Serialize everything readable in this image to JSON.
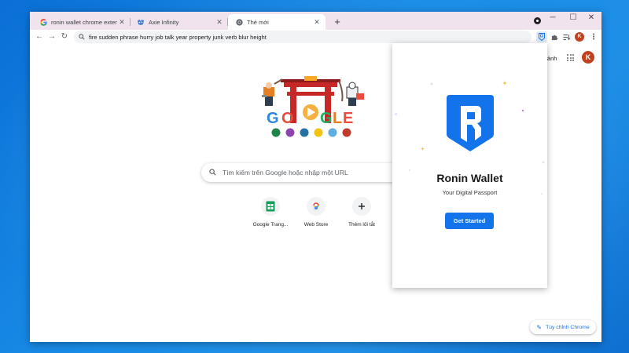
{
  "browser": {
    "tabs": [
      {
        "title": "ronin wallet chrome extension - Go",
        "active": false,
        "favicon": "google-g-icon"
      },
      {
        "title": "Axie Infinity",
        "active": false,
        "favicon": "axie-icon"
      },
      {
        "title": "Thẻ mới",
        "active": true,
        "favicon": "chrome-icon"
      }
    ],
    "new_tab_symbol": "+",
    "window_controls": {
      "minimize": "─",
      "maximize": "☐",
      "close": "✕"
    },
    "omnibox_text": "fire sudden phrase hurry job talk year property junk verb blur height",
    "avatar_letter": "K"
  },
  "ntp": {
    "header_link": "Hình ảnh",
    "avatar_letter": "K",
    "search_placeholder": "Tìm kiếm trên Google hoặc nhập một URL",
    "shortcuts": [
      {
        "label": "Google Trang...",
        "icon": "google-sheets-icon"
      },
      {
        "label": "Web Store",
        "icon": "chrome-web-store-icon"
      },
      {
        "label": "Thêm lối tắt",
        "icon": "plus-icon"
      }
    ],
    "customize_label": "Tùy chỉnh Chrome"
  },
  "ronin": {
    "title": "Ronin Wallet",
    "subtitle": "Your Digital Passport",
    "cta": "Get Started",
    "brand_color": "#1273ea"
  },
  "colors": {
    "titlebar": "#f1e3ee",
    "accent": "#1a73e8",
    "desktop": "#1a8de8"
  }
}
